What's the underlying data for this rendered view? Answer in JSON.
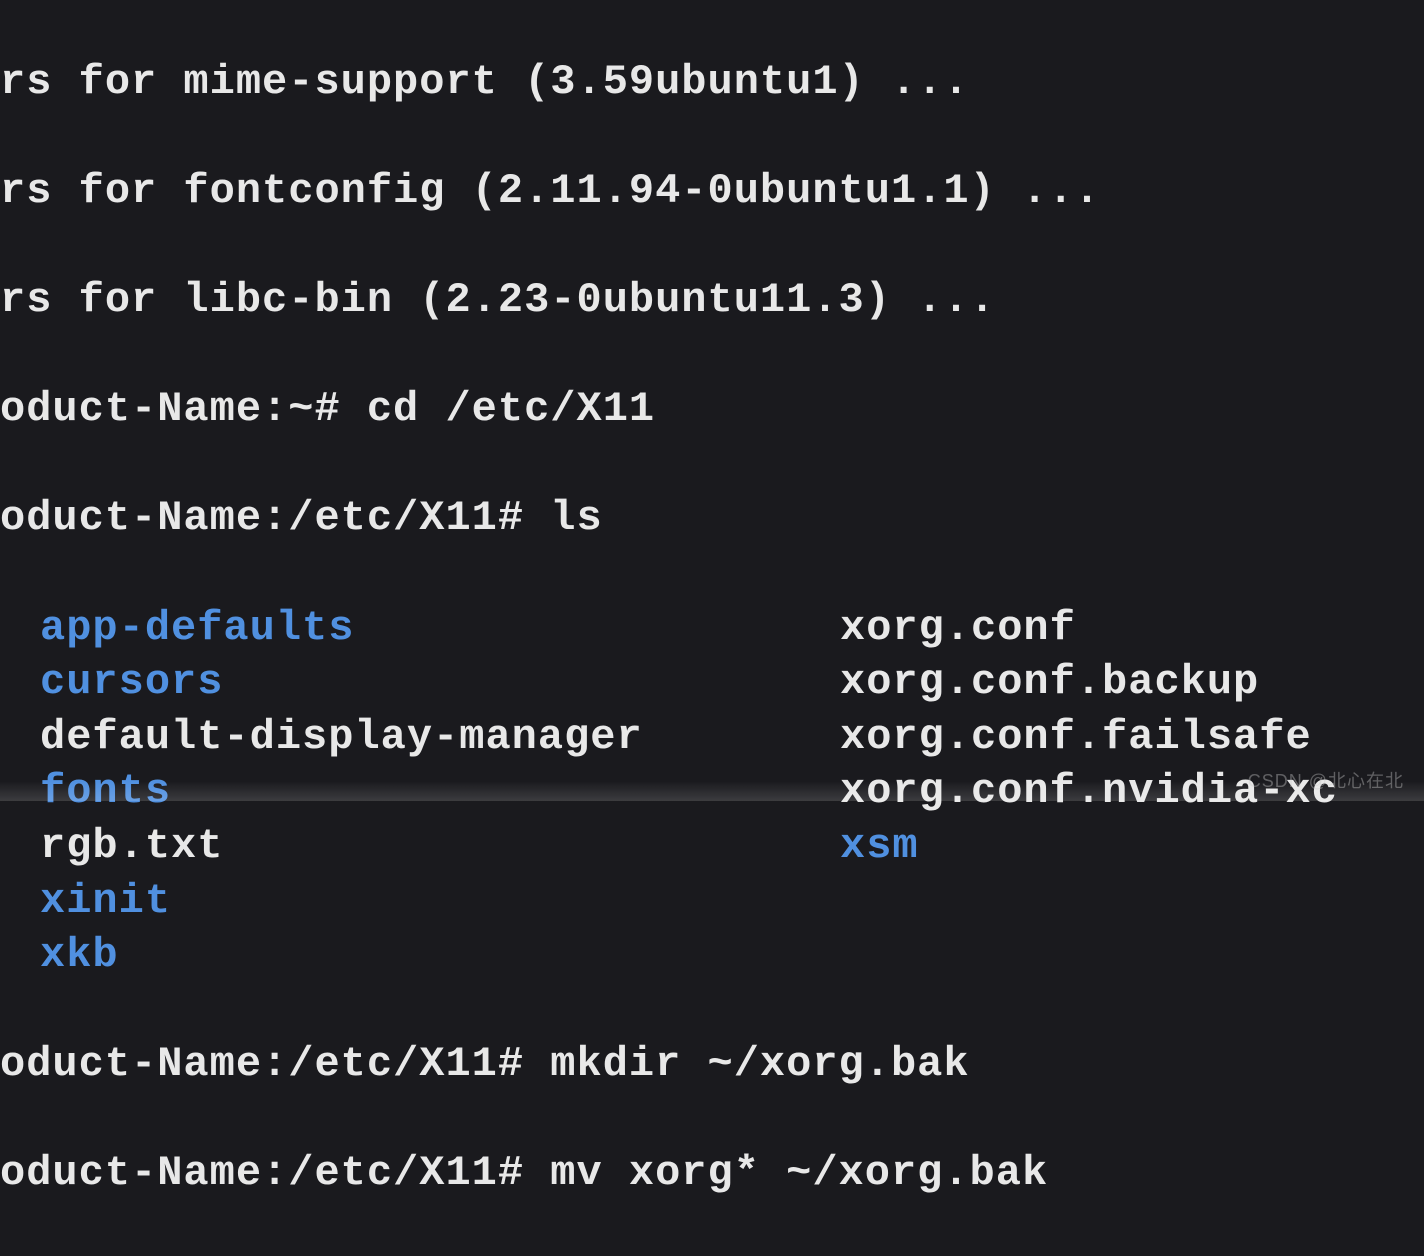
{
  "lines": {
    "trigger1": "rs for mime-support (3.59ubuntu1) ...",
    "trigger2": "rs for fontconfig (2.11.94-0ubuntu1.1) ...",
    "trigger3": "rs for libc-bin (2.23-0ubuntu11.3) ...",
    "prompt1": "oduct-Name:~# cd /etc/X11",
    "prompt2": "oduct-Name:/etc/X11# ls",
    "prompt3": "oduct-Name:/etc/X11# mkdir ~/xorg.bak",
    "prompt4": "oduct-Name:/etc/X11# mv xorg* ~/xorg.bak"
  },
  "ls": {
    "col1": [
      {
        "name": "app-defaults",
        "type": "dir"
      },
      {
        "name": "cursors",
        "type": "dir"
      },
      {
        "name": "default-display-manager",
        "type": "file"
      },
      {
        "name": "fonts",
        "type": "dir"
      },
      {
        "name": "rgb.txt",
        "type": "file"
      },
      {
        "name": "xinit",
        "type": "dir"
      },
      {
        "name": "xkb",
        "type": "dir"
      }
    ],
    "col2": [
      {
        "name": "xorg.conf",
        "type": "file"
      },
      {
        "name": "xorg.conf.backup",
        "type": "file"
      },
      {
        "name": "xorg.conf.failsafe",
        "type": "file"
      },
      {
        "name": "xorg.conf.nvidia-xc",
        "type": "file"
      },
      {
        "name": "xsm",
        "type": "dir"
      }
    ]
  },
  "watermark": "CSDN @北心在北"
}
